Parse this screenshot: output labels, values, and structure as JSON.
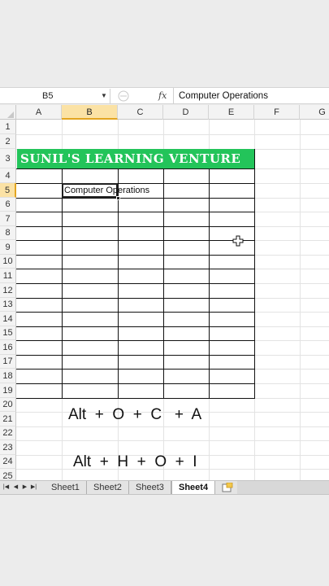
{
  "formula_bar": {
    "name_box": "B5",
    "fx_label": "fx",
    "formula_value": "Computer Operations"
  },
  "columns": [
    "A",
    "B",
    "C",
    "D",
    "E",
    "F",
    "G"
  ],
  "active_column": "B",
  "rows": [
    "1",
    "2",
    "3",
    "4",
    "5",
    "6",
    "7",
    "8",
    "9",
    "10",
    "11",
    "12",
    "13",
    "14",
    "15",
    "16",
    "17",
    "18",
    "19",
    "20",
    "21",
    "22",
    "23",
    "24",
    "25"
  ],
  "active_row": "5",
  "banner": {
    "text": "SUNIL'S LEARNING VENTURE",
    "color": "#23c45a"
  },
  "active_cell": {
    "text": "Computer Operations"
  },
  "shortcuts": {
    "line1": "Alt  +  O  +  C   +  A",
    "line2": "Alt  +  H  +  O  +  I"
  },
  "tabs": {
    "nav_icons": [
      "first-sheet-icon",
      "prev-sheet-icon",
      "next-sheet-icon",
      "last-sheet-icon"
    ],
    "sheets": [
      "Sheet1",
      "Sheet2",
      "Sheet3",
      "Sheet4"
    ],
    "active": "Sheet4"
  },
  "colors": {
    "selection_header": "#fbe2a5",
    "selection_border": "#e3a521"
  }
}
